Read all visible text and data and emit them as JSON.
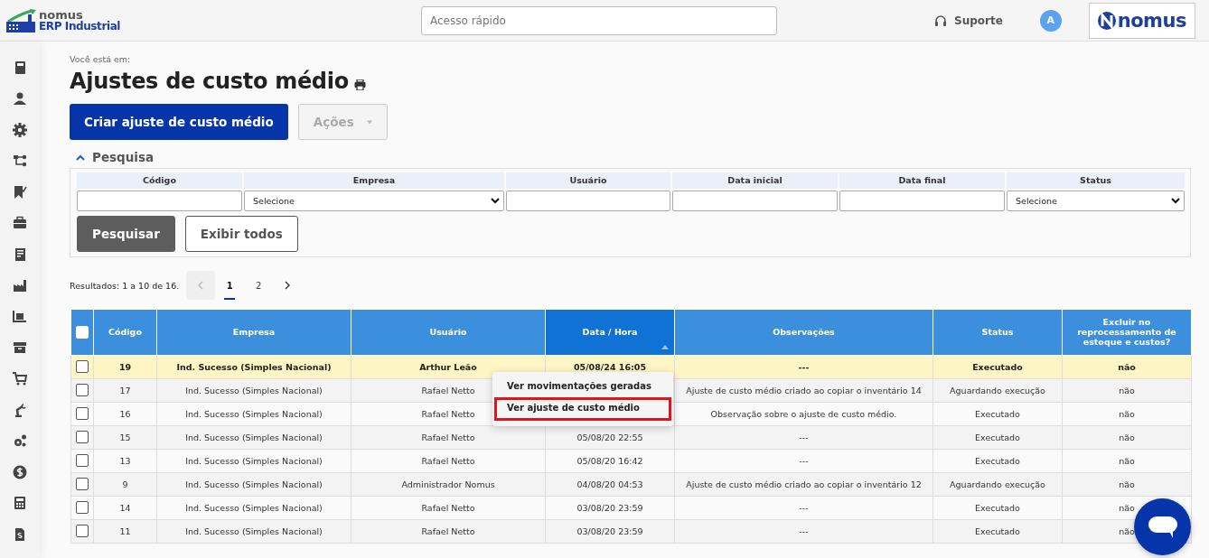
{
  "header": {
    "logo": {
      "line1": "nomus",
      "line2": "ERP Industrial"
    },
    "quick_access": {
      "placeholder": "Acesso rápido"
    },
    "support": "Suporte",
    "avatar": "A",
    "brand": "nomus"
  },
  "breadcrumb": "Você está em:",
  "title": "Ajustes de custo médio",
  "buttons": [
    {
      "kind": "primary",
      "label": "Criar ajuste de custo médio",
      "disabled": false
    },
    {
      "kind": "dropdown",
      "label": "Ações",
      "disabled": true
    }
  ],
  "search": {
    "title": "Pesquisa",
    "expanded": true,
    "fields": [
      {
        "label": "Código",
        "kind": "input"
      },
      {
        "label": "Empresa",
        "kind": "select",
        "value": "Selecione"
      },
      {
        "label": "Usuário",
        "kind": "input"
      },
      {
        "label": "Data inicial",
        "kind": "input"
      },
      {
        "label": "Data final",
        "kind": "input"
      },
      {
        "label": "Status",
        "kind": "select",
        "value": "Selecione"
      }
    ],
    "buttons": [
      {
        "kind": "dark",
        "label": "Pesquisar"
      },
      {
        "kind": "outline",
        "label": "Exibir todos"
      }
    ]
  },
  "results": "Resultados: 1 a 10 de 16.",
  "pagination": {
    "prev_disabled": true,
    "pages": [
      {
        "label": "1",
        "selected": true
      },
      {
        "label": "2",
        "selected": false
      }
    ]
  },
  "table": {
    "select_all_checked": false,
    "columns": [
      {
        "label": "Código",
        "sorted": false
      },
      {
        "label": "Empresa",
        "sorted": false
      },
      {
        "label": "Usuário",
        "sorted": false
      },
      {
        "label": "Data / Hora",
        "sorted": true
      },
      {
        "label": "Observações",
        "sorted": false
      },
      {
        "label": "Status",
        "sorted": false
      },
      {
        "label": "Excluir no reprocessamento de estoque e custos?",
        "sorted": false
      }
    ],
    "rows": [
      {
        "selected": true,
        "checked": false,
        "cells": [
          "19",
          "Ind. Sucesso (Simples Nacional)",
          "Arthur Leão",
          "05/08/24 16:05",
          "---",
          "Executado",
          "não"
        ]
      },
      {
        "selected": false,
        "checked": false,
        "cells": [
          "17",
          "Ind. Sucesso (Simples Nacional)",
          "Rafael Netto",
          "",
          "Ajuste de custo médio criado ao copiar o inventário 14",
          "Aguardando execução",
          "não"
        ]
      },
      {
        "selected": false,
        "checked": false,
        "cells": [
          "16",
          "Ind. Sucesso (Simples Nacional)",
          "Rafael Netto",
          "",
          "Observação sobre o ajuste de custo médio.",
          "Executado",
          "não"
        ]
      },
      {
        "selected": false,
        "checked": false,
        "cells": [
          "15",
          "Ind. Sucesso (Simples Nacional)",
          "Rafael Netto",
          "05/08/20 22:55",
          "---",
          "Executado",
          "não"
        ]
      },
      {
        "selected": false,
        "checked": false,
        "cells": [
          "13",
          "Ind. Sucesso (Simples Nacional)",
          "Rafael Netto",
          "05/08/20 16:42",
          "---",
          "Executado",
          "não"
        ]
      },
      {
        "selected": false,
        "checked": false,
        "cells": [
          "9",
          "Ind. Sucesso (Simples Nacional)",
          "Administrador Nomus",
          "04/08/20 04:53",
          "Ajuste de custo médio criado ao copiar o inventário 12",
          "Aguardando execução",
          "não"
        ]
      },
      {
        "selected": false,
        "checked": false,
        "cells": [
          "14",
          "Ind. Sucesso (Simples Nacional)",
          "Rafael Netto",
          "03/08/20 23:59",
          "---",
          "Executado",
          "não"
        ]
      },
      {
        "selected": false,
        "checked": false,
        "cells": [
          "11",
          "Ind. Sucesso (Simples Nacional)",
          "Rafael Netto",
          "03/08/20 23:59",
          "---",
          "Executado",
          "não"
        ]
      }
    ]
  },
  "context_menu": {
    "items": [
      {
        "label": "Ver movimentações geradas",
        "selected": false
      },
      {
        "label": "Ver ajuste de custo médio",
        "selected": true
      }
    ]
  }
}
